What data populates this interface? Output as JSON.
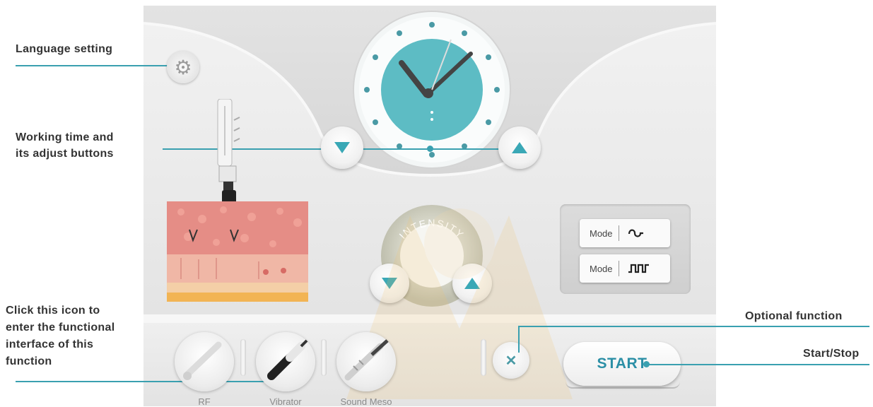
{
  "annotations": {
    "language": "Language setting",
    "working_time_line1": "Working time and",
    "working_time_line2": "its adjust buttons",
    "click_line1": "Click this icon to",
    "click_line2": "enter the functional",
    "click_line3": "interface of this",
    "click_line4": "function",
    "optional": "Optional function",
    "start_stop": "Start/Stop"
  },
  "intensity": {
    "label": "INTENSITY"
  },
  "modes": [
    {
      "label": "Mode",
      "icon": "sine-wave-icon",
      "glyph": "ᔕ"
    },
    {
      "label": "Mode",
      "icon": "square-wave-icon",
      "glyph": "⎍⎍"
    }
  ],
  "tools": [
    {
      "label": "RF",
      "icon": "rf-handpiece-icon"
    },
    {
      "label": "Vibrator",
      "icon": "vibrator-handpiece-icon"
    },
    {
      "label": "Sound Meso",
      "icon": "sound-meso-handpiece-icon"
    }
  ],
  "optional_button": {
    "glyph": "✕"
  },
  "start_button": {
    "label": "START"
  },
  "colors": {
    "accent": "#3aa8b6",
    "clock_face": "#5dbcc4",
    "annotation_line": "#3aa0b0"
  }
}
